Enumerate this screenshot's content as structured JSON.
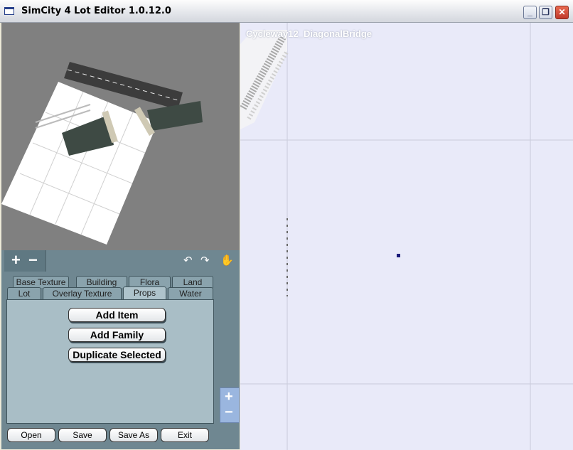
{
  "window": {
    "title": "SimCity 4 Lot Editor 1.0.12.0",
    "minimize_glyph": "_",
    "maximize_glyph": "❐",
    "close_glyph": "✕"
  },
  "toolbar": {
    "zoom_in": "+",
    "zoom_out": "−",
    "icons": [
      "rotate-left-icon",
      "rotate-right-icon",
      "hand-pan-icon"
    ],
    "rotate_left_glyph": "↶",
    "rotate_right_glyph": "↷",
    "hand_glyph": "✋"
  },
  "tabs": {
    "row1": [
      "Base Texture",
      "Building",
      "Flora",
      "Land"
    ],
    "row2": [
      "Lot",
      "Overlay Texture",
      "Props",
      "Water"
    ],
    "active": "Props"
  },
  "props_panel": {
    "add_item": "Add Item",
    "add_family": "Add Family",
    "duplicate_selected": "Duplicate Selected"
  },
  "footer": {
    "open": "Open",
    "save": "Save",
    "save_as": "Save As",
    "exit": "Exit"
  },
  "side_zoom": {
    "plus": "+",
    "minus": "−"
  },
  "lot_view": {
    "lot_name": "Cycleway12_DiagonalBridge"
  },
  "colors": {
    "panel": "#6f8791",
    "tab_body": "#a9bec6",
    "lot_background": "#e9eaf9",
    "grid_line": "#c9cbdb",
    "marker": "#1a1a7a"
  }
}
